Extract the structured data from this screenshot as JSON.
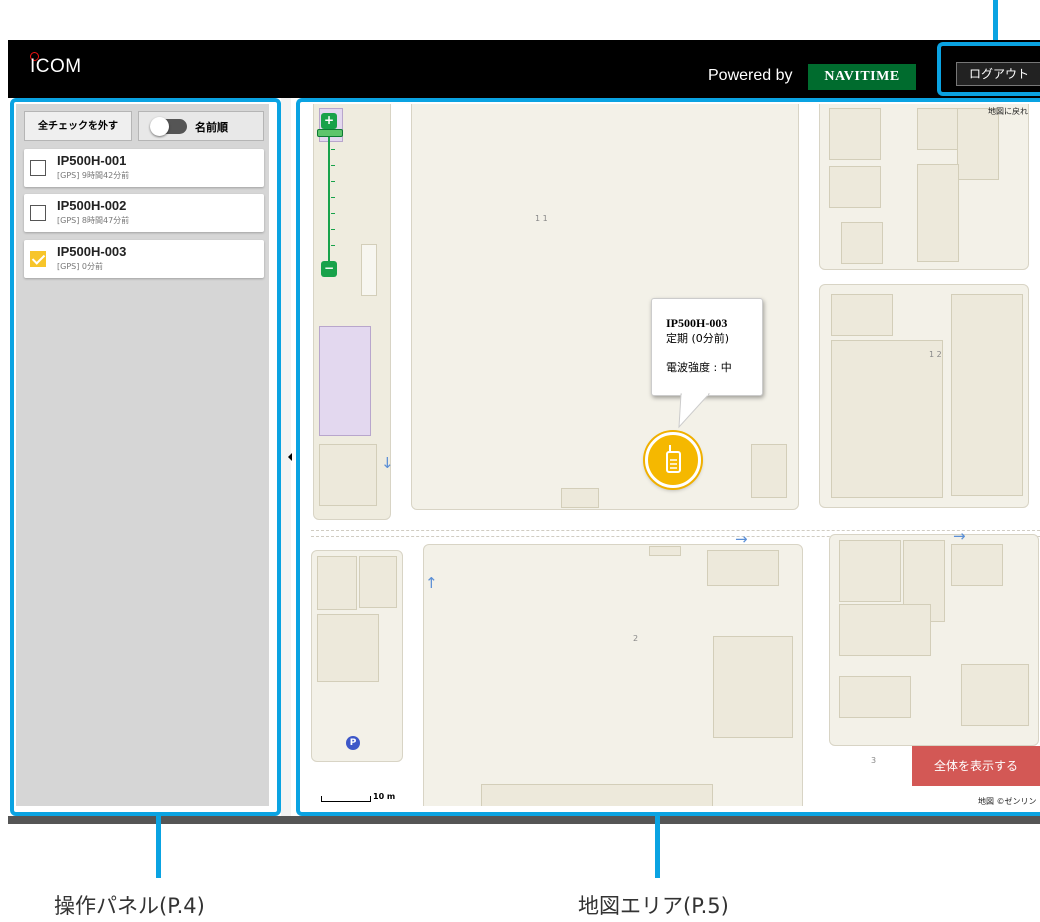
{
  "header": {
    "logo_text": "ICOM",
    "powered_by": "Powered by",
    "navitime": "NAVITIME",
    "logout": "ログアウト"
  },
  "panel": {
    "uncheck_all_label": "全チェックを外す",
    "sort_label": "名前順",
    "devices": [
      {
        "name": "IP500H-001",
        "status": "[GPS] 9時間42分前",
        "checked": false
      },
      {
        "name": "IP500H-002",
        "status": "[GPS] 8時間47分前",
        "checked": false
      },
      {
        "name": "IP500H-003",
        "status": "[GPS] 0分前",
        "checked": true
      }
    ]
  },
  "map": {
    "labels": {
      "block_11": "1 1",
      "block_12": "1 2",
      "block_2": "2",
      "block_3": "3"
    },
    "popup": {
      "name": "IP500H-003",
      "mode": "定期 (0分前)",
      "signal": "電波強度 : 中"
    },
    "show_all_label": "全体を表示する",
    "scale": "10 m",
    "copyright": "地図 ©ゼンリン",
    "top_note": "地図に戻れ",
    "zoom_in": "+",
    "zoom_out": "−",
    "parking": "P"
  },
  "captions": {
    "operation_panel": "操作パネル(P.4)",
    "map_area": "地図エリア(P.5)"
  },
  "colors": {
    "accent_callout": "#0aa3e2",
    "navitime_green": "#006c2e",
    "marker_yellow": "#f5b800",
    "check_yellow": "#f7c52a",
    "show_all_red": "#d35855",
    "zoom_green": "#18a24a"
  }
}
